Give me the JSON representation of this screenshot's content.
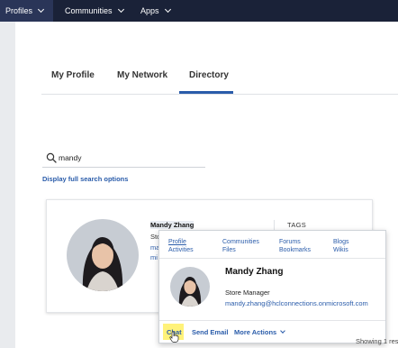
{
  "topnav": {
    "items": [
      {
        "label": "Profiles"
      },
      {
        "label": "Communities"
      },
      {
        "label": "Apps"
      }
    ]
  },
  "tabs": [
    {
      "label": "My Profile"
    },
    {
      "label": "My Network"
    },
    {
      "label": "Directory",
      "active": true
    }
  ],
  "search": {
    "value": "mandy",
    "display_link": "Display full search options"
  },
  "result_card": {
    "name": "Mandy Zhang",
    "fragments": [
      "Sto",
      "ma",
      "mi"
    ],
    "tags_label": "TAGS"
  },
  "business_card": {
    "links_row1": [
      "Profile",
      "Communities",
      "Forums",
      "Blogs"
    ],
    "links_row2": [
      "Activities",
      "Files",
      "Bookmarks",
      "Wikis"
    ],
    "name": "Mandy Zhang",
    "title": "Store Manager",
    "email": "mandy.zhang@hclconnections.onmicrosoft.com",
    "actions": {
      "chat": "Chat",
      "send_email": "Send Email",
      "more_actions": "More Actions"
    }
  },
  "footer": {
    "showing": "Showing 1 res"
  },
  "colors": {
    "nav_bg": "#1a2238",
    "link": "#2a5caa",
    "tab_accent": "#2a5caa",
    "highlight": "#fff27a"
  }
}
